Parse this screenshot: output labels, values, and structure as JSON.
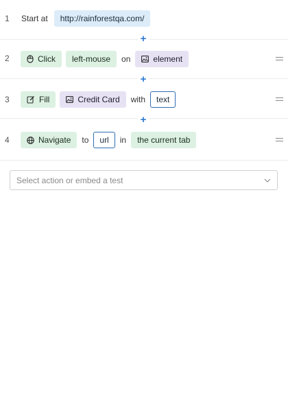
{
  "steps": [
    {
      "number": "1",
      "start_label": "Start at",
      "url": "http://rainforestqa.com/"
    },
    {
      "number": "2",
      "action": "Click",
      "action_icon": "mouse-icon",
      "button": "left-mouse",
      "connector": "on",
      "target": "element",
      "target_icon": "image-icon"
    },
    {
      "number": "3",
      "action": "Fill",
      "action_icon": "edit-icon",
      "target": "Credit Card",
      "target_icon": "image-icon",
      "connector": "with",
      "param": "text"
    },
    {
      "number": "4",
      "action": "Navigate",
      "action_icon": "globe-icon",
      "connector_to": "to",
      "param": "url",
      "connector_in": "in",
      "tab": "the current tab"
    }
  ],
  "add_step_label": "+",
  "action_select": {
    "placeholder": "Select action or embed a test"
  },
  "colors": {
    "url_pill": "#dcecf9",
    "action_pill": "#dcf1e2",
    "element_pill": "#e7e2f3",
    "param_border": "#2e6db4",
    "plus": "#2e7ad1"
  }
}
